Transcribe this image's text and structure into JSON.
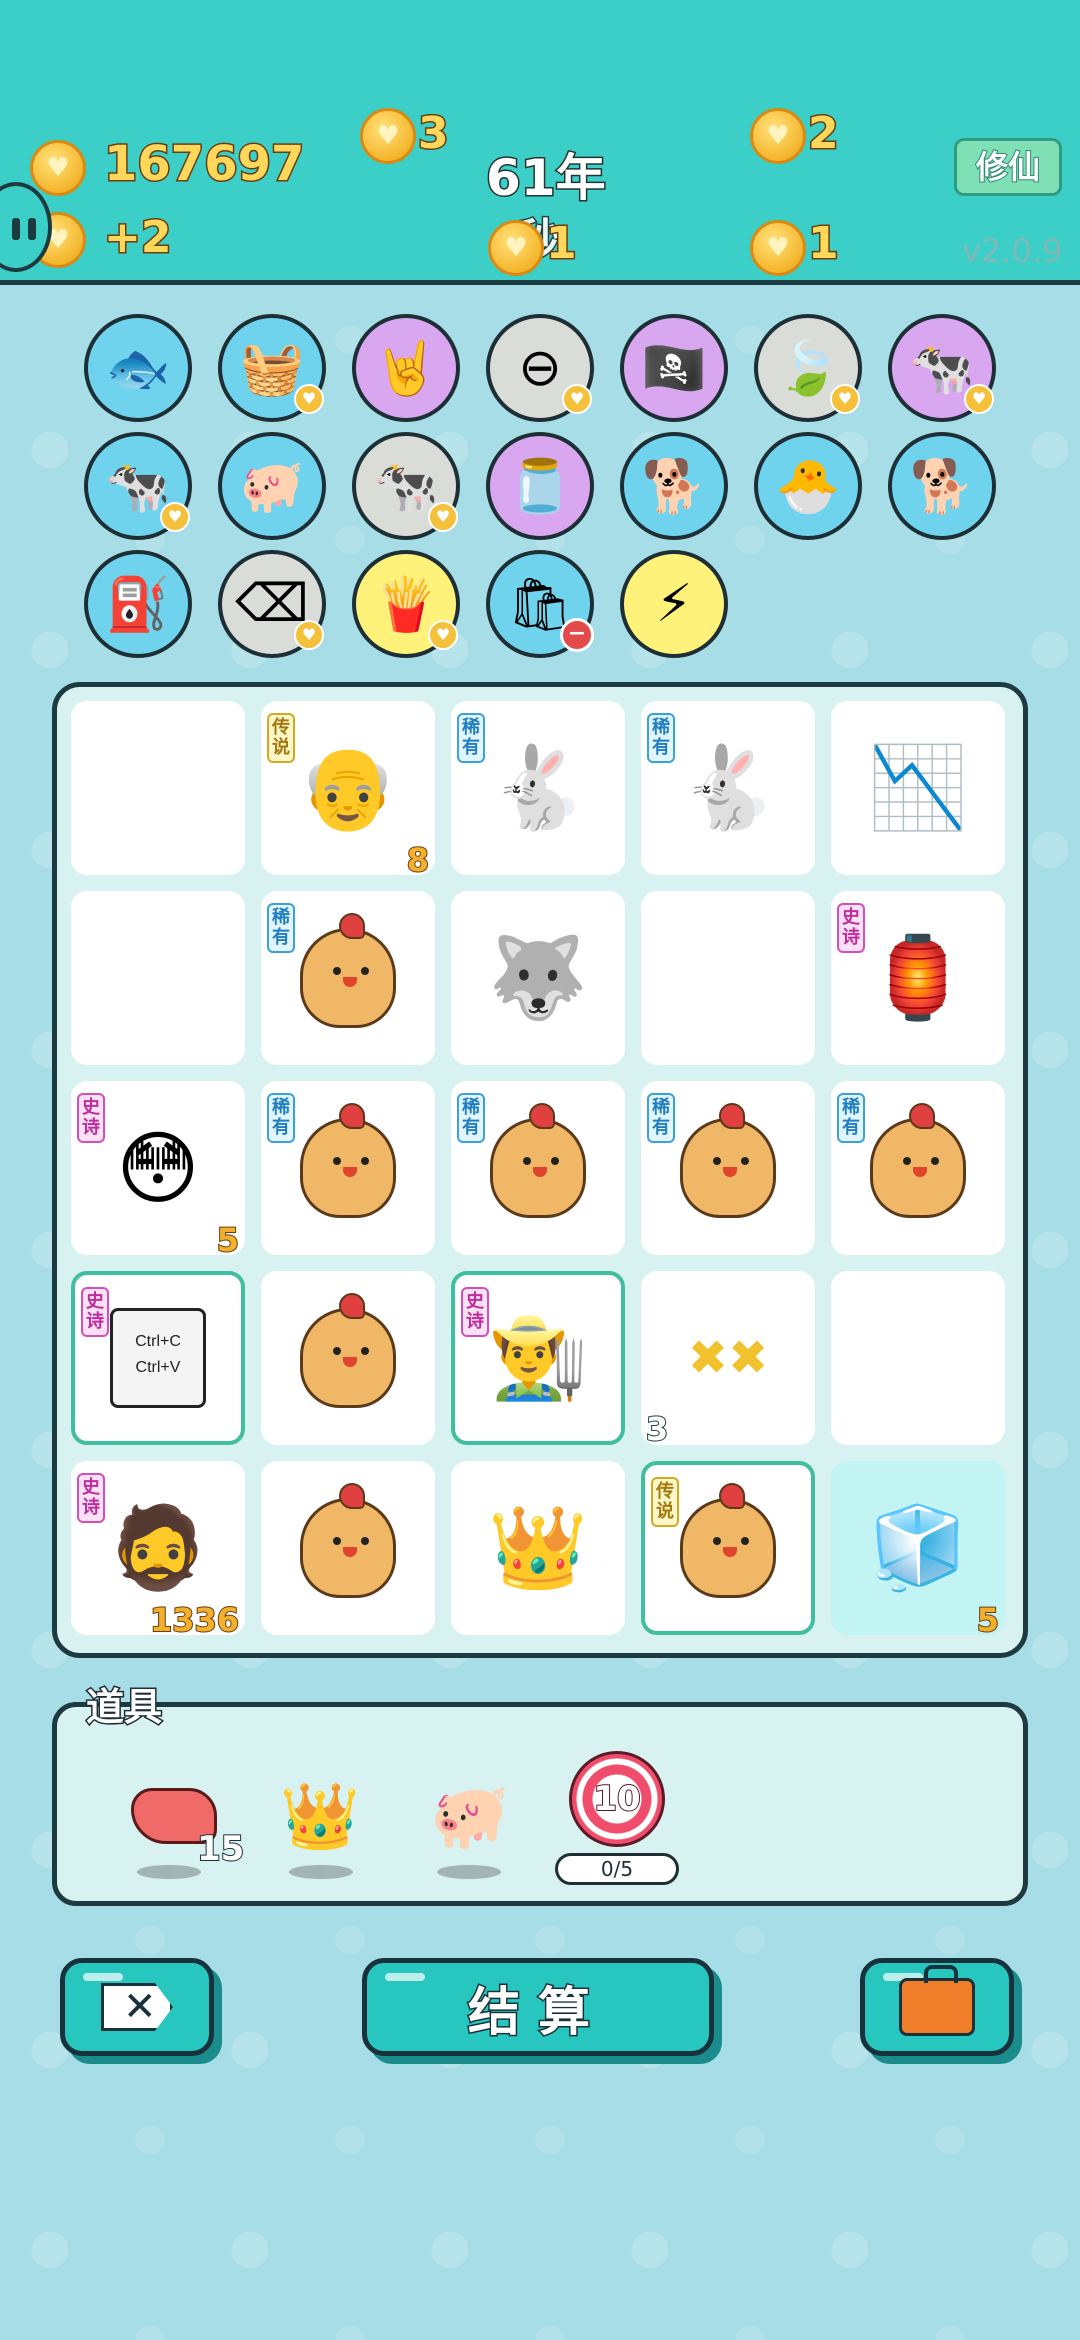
{
  "hud": {
    "gold_total": "167697",
    "gold_rate": "+2",
    "counter_a": "3",
    "counter_b": "1",
    "counter_c": "2",
    "counter_d": "1",
    "year": "61年",
    "partial_text": "秒",
    "cultivate_button": "修仙",
    "version": "v2.0.9"
  },
  "item_circles": [
    {
      "icon": "fish-tank-icon",
      "glyph": "🐟",
      "color": "blue",
      "badge": ""
    },
    {
      "icon": "fruit-basket-icon",
      "glyph": "🧺",
      "color": "blue",
      "badge": "heart"
    },
    {
      "icon": "rock-hand-icon",
      "glyph": "🤘",
      "color": "purple",
      "badge": ""
    },
    {
      "icon": "no-entry-icon",
      "glyph": "⊖",
      "color": "grey",
      "badge": "heart"
    },
    {
      "icon": "eyepatch-icon",
      "glyph": "🏴‍☠️",
      "color": "purple",
      "badge": ""
    },
    {
      "icon": "leaf-icon",
      "glyph": "🍃",
      "color": "grey",
      "badge": "heart"
    },
    {
      "icon": "cow-pair-icon",
      "glyph": "🐄",
      "color": "purple",
      "badge": "heart"
    },
    {
      "icon": "cow-pair-icon",
      "glyph": "🐄",
      "color": "blue",
      "badge": "heart"
    },
    {
      "icon": "piggy-bank-icon",
      "glyph": "🐖",
      "color": "blue",
      "badge": ""
    },
    {
      "icon": "cow-pair-icon",
      "glyph": "🐄",
      "color": "grey",
      "badge": "heart"
    },
    {
      "icon": "jar-icon",
      "glyph": "🫙",
      "color": "purple",
      "badge": ""
    },
    {
      "icon": "cool-dog-icon",
      "glyph": "🐕",
      "color": "blue",
      "badge": ""
    },
    {
      "icon": "chick-egg-icon",
      "glyph": "🐣",
      "color": "blue",
      "badge": ""
    },
    {
      "icon": "cool-dog-icon",
      "glyph": "🐕",
      "color": "blue",
      "badge": ""
    },
    {
      "icon": "air-pump-icon",
      "glyph": "⛽",
      "color": "blue",
      "badge": ""
    },
    {
      "icon": "delete-key-icon",
      "glyph": "⌫",
      "color": "grey",
      "badge": "heart"
    },
    {
      "icon": "fries-icon",
      "glyph": "🍟",
      "color": "yellow",
      "badge": "heart"
    },
    {
      "icon": "sack-icon",
      "glyph": "🛍",
      "color": "blue",
      "badge": "minus"
    },
    {
      "icon": "lightning-icon",
      "glyph": "⚡",
      "color": "yellow",
      "badge": ""
    }
  ],
  "board": [
    {
      "icon": "",
      "glyph": "",
      "rarity": "",
      "count": ""
    },
    {
      "icon": "grandpa-glasses-icon",
      "glyph": "👴",
      "rarity": "传说",
      "rarity_type": "legend",
      "count": "8"
    },
    {
      "icon": "rabbit-icon",
      "glyph": "🐇",
      "rarity": "稀有",
      "rarity_type": "rare",
      "count": ""
    },
    {
      "icon": "rabbit-icon",
      "glyph": "🐇",
      "rarity": "稀有",
      "rarity_type": "rare",
      "count": ""
    },
    {
      "icon": "chart-down-icon",
      "glyph": "📉",
      "rarity": "",
      "count": ""
    },
    {
      "icon": "",
      "glyph": "",
      "rarity": "",
      "count": ""
    },
    {
      "icon": "chick-icon",
      "glyph": "chick",
      "rarity": "稀有",
      "rarity_type": "rare",
      "count": ""
    },
    {
      "icon": "husky-icon",
      "glyph": "🐺",
      "rarity": "",
      "count": ""
    },
    {
      "icon": "",
      "glyph": "",
      "rarity": "",
      "count": ""
    },
    {
      "icon": "rabbit-house-icon",
      "glyph": "🏮",
      "rarity": "史诗",
      "rarity_type": "epic",
      "count": ""
    },
    {
      "icon": "yellow-face-icon",
      "glyph": "😳",
      "rarity": "史诗",
      "rarity_type": "epic",
      "count": "5"
    },
    {
      "icon": "chick-icon",
      "glyph": "chick",
      "rarity": "稀有",
      "rarity_type": "rare",
      "count": ""
    },
    {
      "icon": "chick-icon",
      "glyph": "chick",
      "rarity": "稀有",
      "rarity_type": "rare",
      "count": ""
    },
    {
      "icon": "chick-icon",
      "glyph": "chick",
      "rarity": "稀有",
      "rarity_type": "rare",
      "count": ""
    },
    {
      "icon": "chick-icon",
      "glyph": "chick",
      "rarity": "稀有",
      "rarity_type": "rare",
      "count": ""
    },
    {
      "icon": "copy-paste-icon",
      "glyph": "📋",
      "rarity": "史诗",
      "rarity_type": "epic",
      "count": "",
      "glow": true,
      "card_text": [
        "Ctrl+C",
        "Ctrl+V"
      ]
    },
    {
      "icon": "chick-icon",
      "glyph": "chick",
      "rarity": "",
      "count": ""
    },
    {
      "icon": "farmer-icon",
      "glyph": "👨‍🌾",
      "rarity": "史诗",
      "rarity_type": "epic",
      "count": "",
      "glow": true
    },
    {
      "icon": "double-x-icon",
      "glyph": "✖✖",
      "rarity": "",
      "count": ""
    },
    {
      "icon": "",
      "glyph": "",
      "rarity": "",
      "count": ""
    },
    {
      "icon": "bearded-man-icon",
      "glyph": "🧔",
      "rarity": "史诗",
      "rarity_type": "epic",
      "count": "1336"
    },
    {
      "icon": "chick-icon",
      "glyph": "chick",
      "rarity": "",
      "count": ""
    },
    {
      "icon": "king-husky-icon",
      "glyph": "👑",
      "rarity": "",
      "count": ""
    },
    {
      "icon": "chick-icon",
      "glyph": "chick",
      "rarity": "传说",
      "rarity_type": "legend",
      "count": "",
      "glow": true
    },
    {
      "icon": "fridge-icon",
      "glyph": "🧊",
      "rarity": "",
      "count": "5",
      "cyan": true
    }
  ],
  "outside_count": "3",
  "tools": {
    "label": "道具",
    "liver_count": "15",
    "target_value": "10",
    "progress": "0/5",
    "progress_current": 0,
    "progress_max": 5
  },
  "actions": {
    "settle": "结算"
  }
}
